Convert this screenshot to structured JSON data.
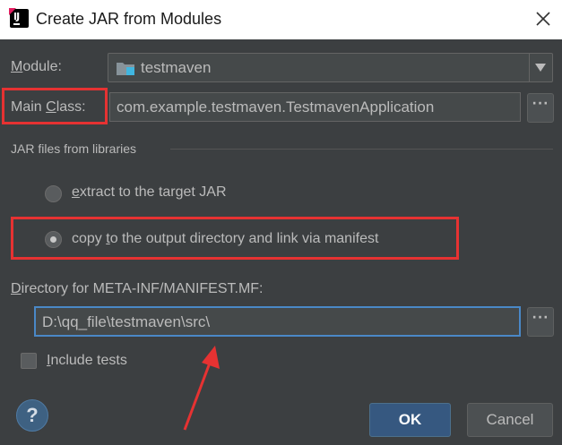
{
  "window": {
    "title": "Create JAR from Modules",
    "close_icon": "close-icon",
    "app_icon": "intellij-idea-icon"
  },
  "module": {
    "label_prefix": "M",
    "label_rest": "odule:",
    "value": "testmaven",
    "icon": "folder-module-icon"
  },
  "main_class": {
    "label_start": "Main ",
    "label_underlined": "C",
    "label_end": "lass:",
    "value": "com.example.testmaven.TestmavenApplication",
    "browse_label": "···"
  },
  "libraries": {
    "section_title": "JAR files from libraries",
    "options": [
      {
        "underlined": "e",
        "rest": "xtract to the target JAR",
        "checked": false
      },
      {
        "before": "copy ",
        "underlined": "t",
        "rest": "o the output directory and link via manifest",
        "checked": true
      }
    ]
  },
  "manifest": {
    "label_underlined": "D",
    "label_rest": "irectory for META-INF/MANIFEST.MF:",
    "value": "D:\\qq_file\\testmaven\\src\\",
    "browse_label": "···"
  },
  "include_tests": {
    "underlined": "I",
    "rest": "nclude tests",
    "checked": false
  },
  "footer": {
    "help_label": "?",
    "ok_label": "OK",
    "cancel_label": "Cancel"
  },
  "colors": {
    "dialog_bg": "#3c3f41",
    "annotation_red": "#e63232",
    "ok_button": "#365880",
    "text": "#bbbbbb"
  }
}
